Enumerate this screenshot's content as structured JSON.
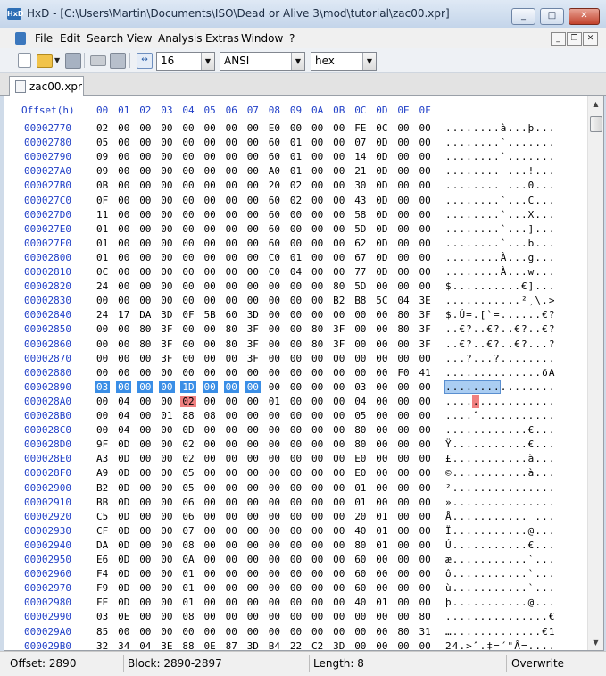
{
  "window": {
    "app_icon_text": "HxD",
    "title": "HxD - [C:\\Users\\Martin\\Documents\\ISO\\Dead or Alive 3\\mod\\tutorial\\zac00.xpr]",
    "minimize": "_",
    "maximize": "□",
    "close": "✕"
  },
  "menu": {
    "items": [
      "File",
      "Edit",
      "Search",
      "View",
      "Analysis",
      "Extras",
      "Window",
      "?"
    ],
    "mdi_minimize": "_",
    "mdi_restore": "❐",
    "mdi_close": "✕"
  },
  "toolbar": {
    "bytes_per_row": "16",
    "charset": "ANSI",
    "offset_base": "hex"
  },
  "tab": {
    "label": "zac00.xpr"
  },
  "editor": {
    "offset_header": "Offset(h)",
    "column_headers": [
      "00",
      "01",
      "02",
      "03",
      "04",
      "05",
      "06",
      "07",
      "08",
      "09",
      "0A",
      "0B",
      "0C",
      "0D",
      "0E",
      "0F"
    ],
    "rows": [
      {
        "offset": "00002770",
        "bytes": [
          "02",
          "00",
          "00",
          "00",
          "00",
          "00",
          "00",
          "00",
          "E0",
          "00",
          "00",
          "00",
          "FE",
          "0C",
          "00",
          "00"
        ],
        "text": "........à...þ..."
      },
      {
        "offset": "00002780",
        "bytes": [
          "05",
          "00",
          "00",
          "00",
          "00",
          "00",
          "00",
          "00",
          "60",
          "01",
          "00",
          "00",
          "07",
          "0D",
          "00",
          "00"
        ],
        "text": "........`......."
      },
      {
        "offset": "00002790",
        "bytes": [
          "09",
          "00",
          "00",
          "00",
          "00",
          "00",
          "00",
          "00",
          "60",
          "01",
          "00",
          "00",
          "14",
          "0D",
          "00",
          "00"
        ],
        "text": "........`......."
      },
      {
        "offset": "000027A0",
        "bytes": [
          "09",
          "00",
          "00",
          "00",
          "00",
          "00",
          "00",
          "00",
          "A0",
          "01",
          "00",
          "00",
          "21",
          "0D",
          "00",
          "00"
        ],
        "text": "........ ...!..."
      },
      {
        "offset": "000027B0",
        "bytes": [
          "0B",
          "00",
          "00",
          "00",
          "00",
          "00",
          "00",
          "00",
          "20",
          "02",
          "00",
          "00",
          "30",
          "0D",
          "00",
          "00"
        ],
        "text": "........ ...0..."
      },
      {
        "offset": "000027C0",
        "bytes": [
          "0F",
          "00",
          "00",
          "00",
          "00",
          "00",
          "00",
          "00",
          "60",
          "02",
          "00",
          "00",
          "43",
          "0D",
          "00",
          "00"
        ],
        "text": "........`...C..."
      },
      {
        "offset": "000027D0",
        "bytes": [
          "11",
          "00",
          "00",
          "00",
          "00",
          "00",
          "00",
          "00",
          "60",
          "00",
          "00",
          "00",
          "58",
          "0D",
          "00",
          "00"
        ],
        "text": "........`...X..."
      },
      {
        "offset": "000027E0",
        "bytes": [
          "01",
          "00",
          "00",
          "00",
          "00",
          "00",
          "00",
          "00",
          "60",
          "00",
          "00",
          "00",
          "5D",
          "0D",
          "00",
          "00"
        ],
        "text": "........`...]..."
      },
      {
        "offset": "000027F0",
        "bytes": [
          "01",
          "00",
          "00",
          "00",
          "00",
          "00",
          "00",
          "00",
          "60",
          "00",
          "00",
          "00",
          "62",
          "0D",
          "00",
          "00"
        ],
        "text": "........`...b..."
      },
      {
        "offset": "00002800",
        "bytes": [
          "01",
          "00",
          "00",
          "00",
          "00",
          "00",
          "00",
          "00",
          "C0",
          "01",
          "00",
          "00",
          "67",
          "0D",
          "00",
          "00"
        ],
        "text": "........À...g..."
      },
      {
        "offset": "00002810",
        "bytes": [
          "0C",
          "00",
          "00",
          "00",
          "00",
          "00",
          "00",
          "00",
          "C0",
          "04",
          "00",
          "00",
          "77",
          "0D",
          "00",
          "00"
        ],
        "text": "........À...w..."
      },
      {
        "offset": "00002820",
        "bytes": [
          "24",
          "00",
          "00",
          "00",
          "00",
          "00",
          "00",
          "00",
          "00",
          "00",
          "00",
          "80",
          "5D",
          "00",
          "00",
          "00"
        ],
        "text": "$..........€]..."
      },
      {
        "offset": "00002830",
        "bytes": [
          "00",
          "00",
          "00",
          "00",
          "00",
          "00",
          "00",
          "00",
          "00",
          "00",
          "00",
          "B2",
          "B8",
          "5C",
          "04",
          "3E"
        ],
        "text": "...........²¸\\.>"
      },
      {
        "offset": "00002840",
        "bytes": [
          "24",
          "17",
          "DA",
          "3D",
          "0F",
          "5B",
          "60",
          "3D",
          "00",
          "00",
          "00",
          "00",
          "00",
          "00",
          "80",
          "3F"
        ],
        "text": "$.Ú=.[`=......€?"
      },
      {
        "offset": "00002850",
        "bytes": [
          "00",
          "00",
          "80",
          "3F",
          "00",
          "00",
          "80",
          "3F",
          "00",
          "00",
          "80",
          "3F",
          "00",
          "00",
          "80",
          "3F"
        ],
        "text": "..€?..€?..€?..€?"
      },
      {
        "offset": "00002860",
        "bytes": [
          "00",
          "00",
          "80",
          "3F",
          "00",
          "00",
          "80",
          "3F",
          "00",
          "00",
          "80",
          "3F",
          "00",
          "00",
          "00",
          "3F"
        ],
        "text": "..€?..€?..€?...?"
      },
      {
        "offset": "00002870",
        "bytes": [
          "00",
          "00",
          "00",
          "3F",
          "00",
          "00",
          "00",
          "3F",
          "00",
          "00",
          "00",
          "00",
          "00",
          "00",
          "00",
          "00"
        ],
        "text": "...?...?........"
      },
      {
        "offset": "00002880",
        "bytes": [
          "00",
          "00",
          "00",
          "00",
          "00",
          "00",
          "00",
          "00",
          "00",
          "00",
          "00",
          "00",
          "00",
          "00",
          "F0",
          "41"
        ],
        "text": "..............ðA"
      },
      {
        "offset": "00002890",
        "bytes": [
          "03",
          "00",
          "00",
          "00",
          "1D",
          "00",
          "00",
          "00",
          "00",
          "00",
          "00",
          "00",
          "03",
          "00",
          "00",
          "00"
        ],
        "text": "................"
      },
      {
        "offset": "000028A0",
        "bytes": [
          "00",
          "04",
          "00",
          "00",
          "02",
          "00",
          "00",
          "00",
          "01",
          "00",
          "00",
          "00",
          "04",
          "00",
          "00",
          "00"
        ],
        "text": "................"
      },
      {
        "offset": "000028B0",
        "bytes": [
          "00",
          "04",
          "00",
          "01",
          "88",
          "08",
          "00",
          "00",
          "00",
          "00",
          "00",
          "00",
          "05",
          "00",
          "00",
          "00"
        ],
        "text": "....ˆ..........."
      },
      {
        "offset": "000028C0",
        "bytes": [
          "00",
          "04",
          "00",
          "00",
          "0D",
          "00",
          "00",
          "00",
          "00",
          "00",
          "00",
          "00",
          "80",
          "00",
          "00",
          "00"
        ],
        "text": "............€..."
      },
      {
        "offset": "000028D0",
        "bytes": [
          "9F",
          "0D",
          "00",
          "00",
          "02",
          "00",
          "00",
          "00",
          "00",
          "00",
          "00",
          "00",
          "80",
          "00",
          "00",
          "00"
        ],
        "text": "Ÿ...........€..."
      },
      {
        "offset": "000028E0",
        "bytes": [
          "A3",
          "0D",
          "00",
          "00",
          "02",
          "00",
          "00",
          "00",
          "00",
          "00",
          "00",
          "00",
          "E0",
          "00",
          "00",
          "00"
        ],
        "text": "£...........à..."
      },
      {
        "offset": "000028F0",
        "bytes": [
          "A9",
          "0D",
          "00",
          "00",
          "05",
          "00",
          "00",
          "00",
          "00",
          "00",
          "00",
          "00",
          "E0",
          "00",
          "00",
          "00"
        ],
        "text": "©...........à..."
      },
      {
        "offset": "00002900",
        "bytes": [
          "B2",
          "0D",
          "00",
          "00",
          "05",
          "00",
          "00",
          "00",
          "00",
          "00",
          "00",
          "00",
          "01",
          "00",
          "00",
          "00"
        ],
        "text": "²..............."
      },
      {
        "offset": "00002910",
        "bytes": [
          "BB",
          "0D",
          "00",
          "00",
          "06",
          "00",
          "00",
          "00",
          "00",
          "00",
          "00",
          "00",
          "01",
          "00",
          "00",
          "00"
        ],
        "text": "»..............."
      },
      {
        "offset": "00002920",
        "bytes": [
          "C5",
          "0D",
          "00",
          "00",
          "06",
          "00",
          "00",
          "00",
          "00",
          "00",
          "00",
          "00",
          "20",
          "01",
          "00",
          "00"
        ],
        "text": "Å........... ..."
      },
      {
        "offset": "00002930",
        "bytes": [
          "CF",
          "0D",
          "00",
          "00",
          "07",
          "00",
          "00",
          "00",
          "00",
          "00",
          "00",
          "00",
          "40",
          "01",
          "00",
          "00"
        ],
        "text": "Ï...........@..."
      },
      {
        "offset": "00002940",
        "bytes": [
          "DA",
          "0D",
          "00",
          "00",
          "08",
          "00",
          "00",
          "00",
          "00",
          "00",
          "00",
          "00",
          "80",
          "01",
          "00",
          "00"
        ],
        "text": "Ú...........€..."
      },
      {
        "offset": "00002950",
        "bytes": [
          "E6",
          "0D",
          "00",
          "00",
          "0A",
          "00",
          "00",
          "00",
          "00",
          "00",
          "00",
          "00",
          "60",
          "00",
          "00",
          "00"
        ],
        "text": "æ...........`..."
      },
      {
        "offset": "00002960",
        "bytes": [
          "F4",
          "0D",
          "00",
          "00",
          "01",
          "00",
          "00",
          "00",
          "00",
          "00",
          "00",
          "00",
          "60",
          "00",
          "00",
          "00"
        ],
        "text": "ô...........`..."
      },
      {
        "offset": "00002970",
        "bytes": [
          "F9",
          "0D",
          "00",
          "00",
          "01",
          "00",
          "00",
          "00",
          "00",
          "00",
          "00",
          "00",
          "60",
          "00",
          "00",
          "00"
        ],
        "text": "ù...........`..."
      },
      {
        "offset": "00002980",
        "bytes": [
          "FE",
          "0D",
          "00",
          "00",
          "01",
          "00",
          "00",
          "00",
          "00",
          "00",
          "00",
          "00",
          "40",
          "01",
          "00",
          "00"
        ],
        "text": "þ...........@..."
      },
      {
        "offset": "00002990",
        "bytes": [
          "03",
          "0E",
          "00",
          "00",
          "08",
          "00",
          "00",
          "00",
          "00",
          "00",
          "00",
          "00",
          "00",
          "00",
          "00",
          "80"
        ],
        "text": "...............€"
      },
      {
        "offset": "000029A0",
        "bytes": [
          "85",
          "00",
          "00",
          "00",
          "00",
          "00",
          "00",
          "00",
          "00",
          "00",
          "00",
          "00",
          "00",
          "00",
          "80",
          "31"
        ],
        "text": "….............€1"
      },
      {
        "offset": "000029B0",
        "bytes": [
          "32",
          "34",
          "04",
          "3E",
          "88",
          "0E",
          "87",
          "3D",
          "B4",
          "22",
          "C2",
          "3D",
          "00",
          "00",
          "00",
          "00"
        ],
        "text": "24.>ˆ.‡=´\"Â=...."
      }
    ]
  },
  "status": {
    "offset": "Offset: 2890",
    "block": "Block: 2890-2897",
    "length": "Length: 8",
    "mode": "Overwrite"
  }
}
